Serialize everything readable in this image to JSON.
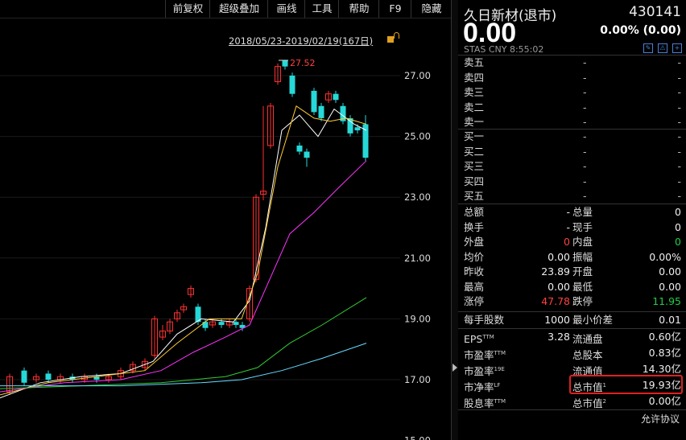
{
  "toolbar": {
    "buttons": [
      "前复权",
      "超级叠加",
      "画线",
      "工具",
      "帮助",
      "F9",
      "隐藏"
    ]
  },
  "chart": {
    "range_label": "2018/05/23-2019/02/19(167日)",
    "max_label": "27.52",
    "y_ticks": [
      "27.00",
      "25.00",
      "23.00",
      "21.00",
      "19.00",
      "17.00",
      "15.00"
    ]
  },
  "chart_data": {
    "type": "candlestick",
    "y_ticks": [
      27.0,
      25.0,
      23.0,
      21.0,
      19.0,
      17.0,
      15.0
    ],
    "max_marker": 27.52,
    "colors": {
      "up": "#ff3030",
      "down": "#26d8d8",
      "ma5": "#ffffff",
      "ma10": "#ffcc33",
      "ma20": "#ff33ff",
      "ma30": "#33cc33",
      "ma60": "#66ddff"
    }
  },
  "quote": {
    "name": "久日新材(退市)",
    "code": "430141",
    "price": "0.00",
    "change": "0.00% (0.00)",
    "subline": "STAS CNY 8:55:02"
  },
  "orderbook": {
    "sell": [
      "卖五",
      "卖四",
      "卖三",
      "卖二",
      "卖一"
    ],
    "buy": [
      "买一",
      "买二",
      "买三",
      "买四",
      "买五"
    ],
    "empty": "-"
  },
  "stats": [
    {
      "l1": "总额",
      "v1": "-",
      "l2": "总量",
      "v2": "0"
    },
    {
      "l1": "换手",
      "v1": "-",
      "l2": "现手",
      "v2": "0"
    },
    {
      "l1": "外盘",
      "v1": "0",
      "l2": "内盘",
      "v2": "0"
    },
    {
      "l1": "均价",
      "v1": "0.00",
      "l2": "振幅",
      "v2": "0.00%"
    },
    {
      "l1": "昨收",
      "v1": "23.89",
      "l2": "开盘",
      "v2": "0.00"
    },
    {
      "l1": "最高",
      "v1": "0.00",
      "l2": "最低",
      "v2": "0.00"
    },
    {
      "l1": "涨停",
      "v1": "47.78",
      "l2": "跌停",
      "v2": "11.95"
    }
  ],
  "stats2": [
    {
      "l1": "每手股数",
      "v1": "1000",
      "l2": "最小价差",
      "v2": "0.01"
    }
  ],
  "fund": [
    {
      "l1": "EPS",
      "s1": "TTM",
      "v1": "3.28",
      "l2": "流通盘",
      "s2": "",
      "v2": "0.60亿"
    },
    {
      "l1": "市盈率",
      "s1": "TTM",
      "v1": "",
      "l2": "总股本",
      "s2": "",
      "v2": "0.83亿"
    },
    {
      "l1": "市盈率",
      "s1": "19E",
      "v1": "",
      "l2": "流通值",
      "s2": "",
      "v2": "14.30亿"
    },
    {
      "l1": "市净率",
      "s1": "LF",
      "v1": "",
      "l2": "总市值",
      "s2": "1",
      "v2": "19.93亿"
    },
    {
      "l1": "股息率",
      "s1": "TTM",
      "v1": "",
      "l2": "总市值",
      "s2": "2",
      "v2": "0.00亿"
    }
  ],
  "footer": {
    "allow": "允许协议"
  }
}
